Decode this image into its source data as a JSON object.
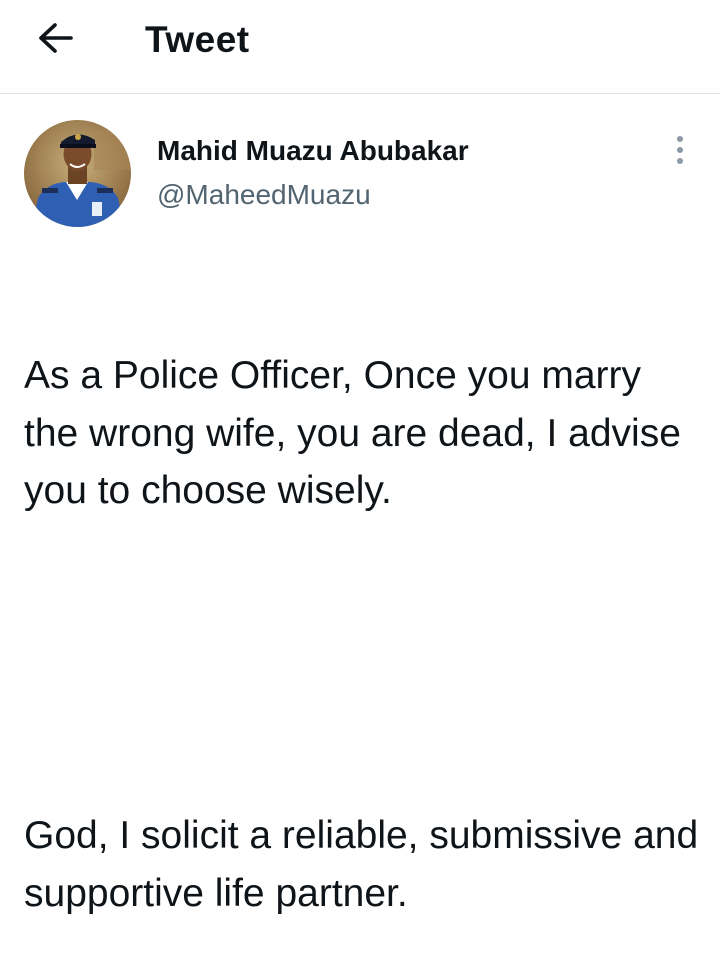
{
  "header": {
    "back_icon": "arrow-left-icon",
    "title": "Tweet"
  },
  "tweet": {
    "author": {
      "name": "Mahid Muazu Abubakar",
      "handle": "@MaheedMuazu",
      "avatar_icon": "profile-photo-police-officer"
    },
    "more_icon": "more-vertical-icon",
    "paragraphs": [
      "As a Police Officer, Once you marry the wrong wife, you are dead, I advise you to choose wisely.",
      "God, I solicit a reliable, submissive and supportive life partner."
    ]
  },
  "colors": {
    "text": "#0f1419",
    "secondary_text": "#536471",
    "divider": "#e1e4e6"
  }
}
